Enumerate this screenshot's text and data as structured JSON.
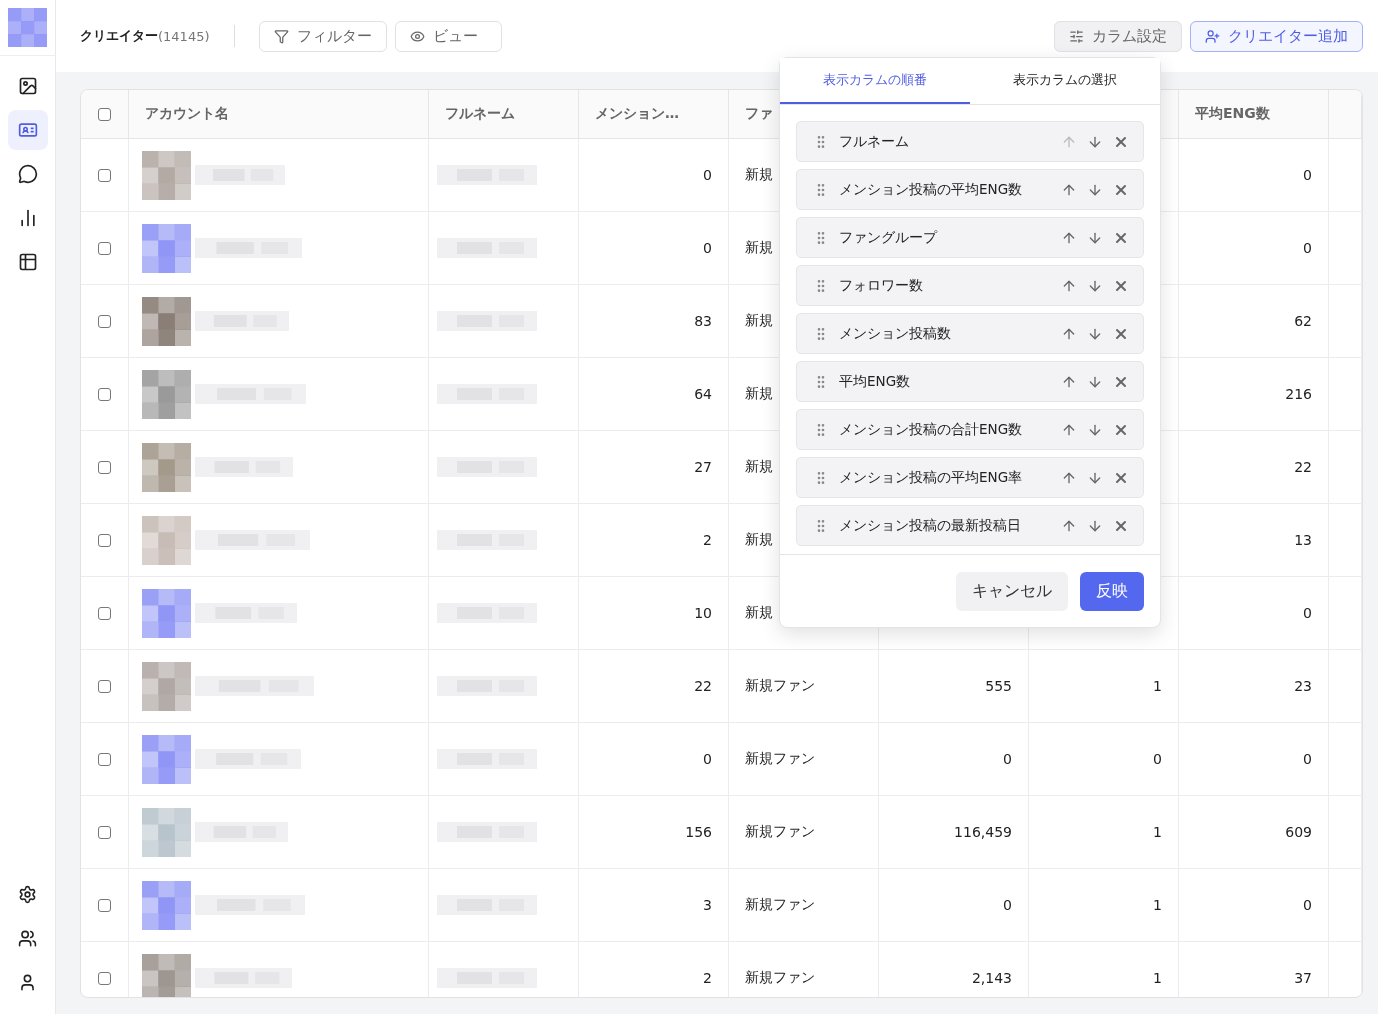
{
  "sidebar": {
    "items": [
      {
        "selected": false
      },
      {
        "selected": true
      },
      {
        "selected": false
      },
      {
        "selected": false
      },
      {
        "selected": false
      }
    ]
  },
  "header": {
    "title": "クリエイター",
    "count": "(14145)",
    "filter_button": "フィルター",
    "view_button": "ビュー",
    "column_settings_button": "カラム設定",
    "add_button": "クリエイター追加"
  },
  "table": {
    "select_all": {
      "checked": false
    },
    "columns": [
      "アカウント名",
      "フルネーム",
      "メンション…",
      "ファ",
      "",
      "",
      "平均ENG数"
    ],
    "rows": [
      {
        "checked": false,
        "mentions": "0",
        "fan_group": "新規",
        "avg_eng": "0"
      },
      {
        "checked": false,
        "mentions": "0",
        "fan_group": "新規",
        "avg_eng": "0"
      },
      {
        "checked": false,
        "mentions": "83",
        "fan_group": "新規",
        "avg_eng": "62"
      },
      {
        "checked": false,
        "mentions": "64",
        "fan_group": "新規",
        "avg_eng": "216"
      },
      {
        "checked": false,
        "mentions": "27",
        "fan_group": "新規",
        "avg_eng": "22"
      },
      {
        "checked": false,
        "mentions": "2",
        "fan_group": "新規",
        "avg_eng": "13"
      },
      {
        "checked": false,
        "mentions": "10",
        "fan_group": "新規",
        "avg_eng": "0"
      },
      {
        "checked": false,
        "mentions": "22",
        "fan_group": "新規ファン",
        "column_5": "555",
        "column_6": "1",
        "avg_eng": "23"
      },
      {
        "checked": false,
        "mentions": "0",
        "fan_group": "新規ファン",
        "column_5": "0",
        "column_6": "0",
        "avg_eng": "0"
      },
      {
        "checked": false,
        "mentions": "156",
        "fan_group": "新規ファン",
        "column_5": "116,459",
        "column_6": "1",
        "avg_eng": "609"
      },
      {
        "checked": false,
        "mentions": "3",
        "fan_group": "新規ファン",
        "column_5": "0",
        "column_6": "1",
        "avg_eng": "0"
      },
      {
        "checked": false,
        "mentions": "2",
        "fan_group": "新規ファン",
        "column_5": "2,143",
        "column_6": "1",
        "avg_eng": "37"
      }
    ]
  },
  "column_popover": {
    "tabs": [
      {
        "label": "表示カラムの順番",
        "selected": true
      },
      {
        "label": "表示カラムの選択",
        "selected": false
      }
    ],
    "items": [
      {
        "label": "フルネーム",
        "up_disabled": true
      },
      {
        "label": "メンション投稿の平均ENG数",
        "up_disabled": false
      },
      {
        "label": "ファングループ",
        "up_disabled": false
      },
      {
        "label": "フォロワー数",
        "up_disabled": false
      },
      {
        "label": "メンション投稿数",
        "up_disabled": false
      },
      {
        "label": "平均ENG数",
        "up_disabled": false
      },
      {
        "label": "メンション投稿の合計ENG数",
        "up_disabled": false
      },
      {
        "label": "メンション投稿の平均ENG率",
        "up_disabled": false
      },
      {
        "label": "メンション投稿の最新投稿日",
        "up_disabled": false
      }
    ],
    "cancel_button": "キャンセル",
    "apply_button": "反映"
  }
}
